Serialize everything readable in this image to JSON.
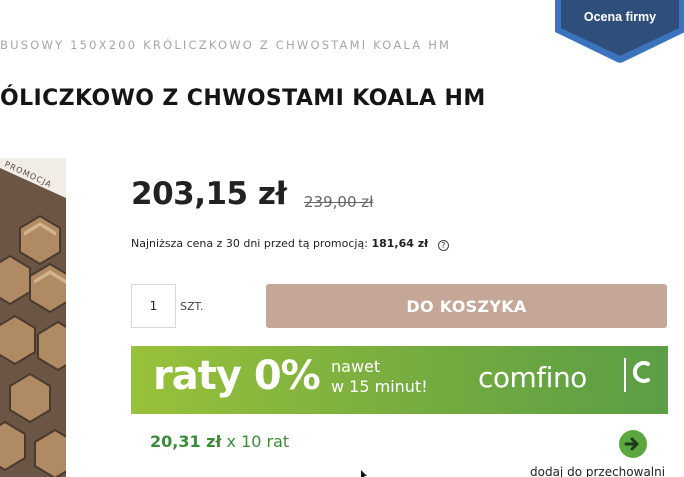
{
  "breadcrumb": "BUSOWY 150X200 KRÓLICZKOWO Z CHWOSTAMI KOALA HM",
  "product": {
    "title": "ÓLICZKOWO Z CHWOSTAMI KOALA HM",
    "promo_tag": "PROMOCJA",
    "price": "203,15 zł",
    "old_price": "239,00 zł",
    "lowest_label": "Najniższa cena z 30 dni przed tą promocją:",
    "lowest_value": "181,64 zł",
    "help_icon": "?"
  },
  "rating_badge": {
    "label": "Ocena firmy"
  },
  "cart": {
    "quantity": "1",
    "unit": "SZT.",
    "button_label": "DO KOSZYKA"
  },
  "financing": {
    "headline": "raty 0%",
    "line1": "nawet",
    "line2": "w 15 minut!",
    "brand": "comfino",
    "installment_amount": "20,31 zł",
    "installment_suffix": " x 10 rat"
  },
  "wishlist_label": "dodaj do przechowalni",
  "colors": {
    "cart_button": "#c4a797",
    "banner_start": "#99c13a",
    "banner_end": "#5a9e45",
    "installment_text": "#3c8a3a",
    "badge": "#2f4e79"
  },
  "icons": {
    "help": "question-circle-icon",
    "go": "arrow-right-circle-icon",
    "badge": "shield-badge-icon"
  }
}
